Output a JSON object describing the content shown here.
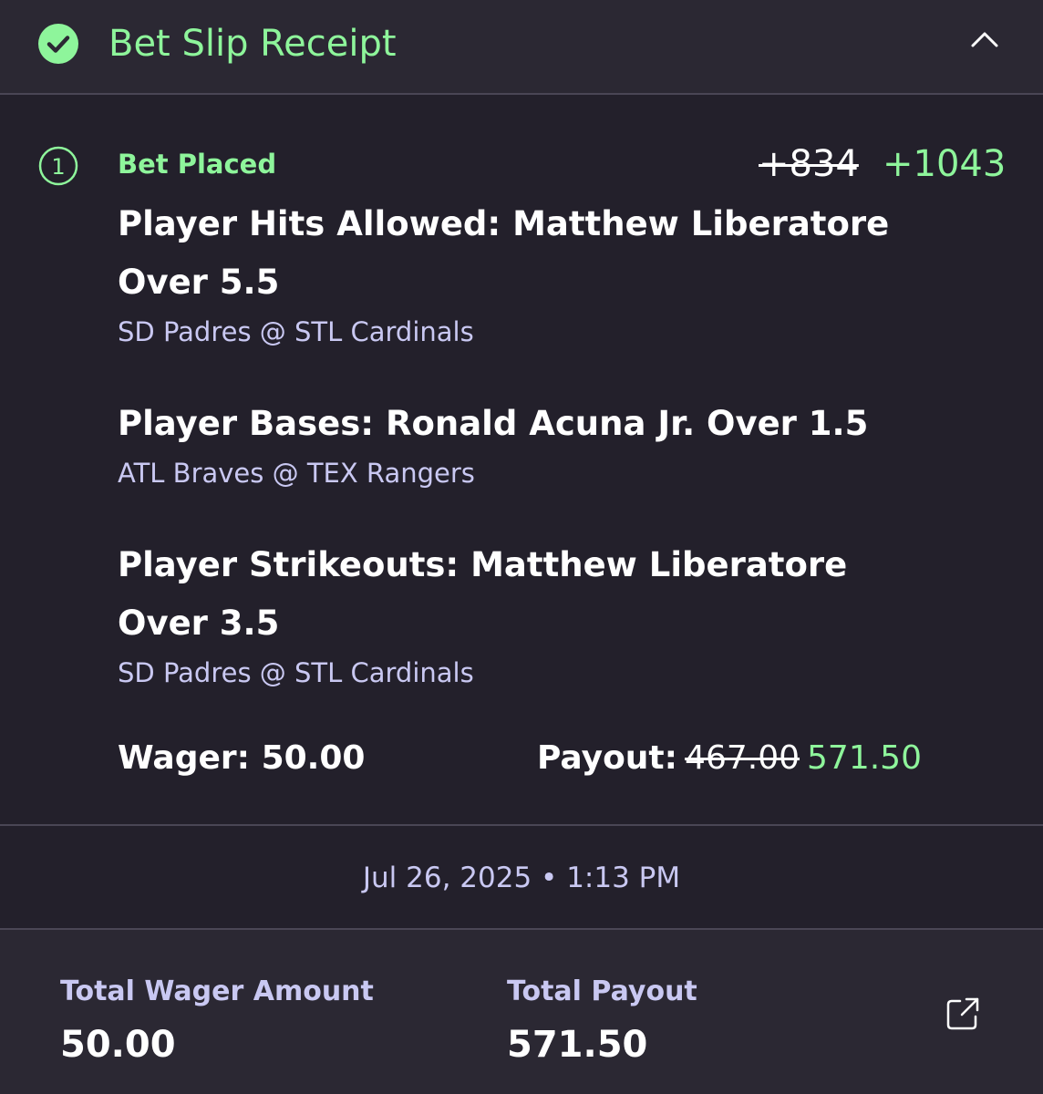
{
  "header": {
    "title": "Bet Slip Receipt",
    "status_icon": "check-circle-icon",
    "collapse_icon": "chevron-up-icon",
    "accent_color": "#8ef59b"
  },
  "bet": {
    "number": "1",
    "status": "Bet Placed",
    "odds_original": "+834",
    "odds_boosted": "+1043",
    "legs": [
      {
        "title": "Player Hits Allowed: Matthew Liberatore Over 5.5",
        "matchup": "SD Padres @ STL Cardinals"
      },
      {
        "title": "Player Bases: Ronald Acuna Jr. Over 1.5",
        "matchup": "ATL Braves @ TEX Rangers"
      },
      {
        "title": "Player Strikeouts: Matthew Liberatore Over 3.5",
        "matchup": "SD Padres @ STL Cardinals"
      }
    ],
    "wager_text": "Wager: 50.00",
    "payout_label": "Payout:",
    "payout_original": "467.00",
    "payout_boosted": "571.50"
  },
  "timestamp": "Jul 26, 2025 • 1:13 PM",
  "totals": {
    "wager_label": "Total Wager Amount",
    "wager_value": "50.00",
    "payout_label": "Total Payout",
    "payout_value": "571.50",
    "share_icon": "share-icon"
  }
}
